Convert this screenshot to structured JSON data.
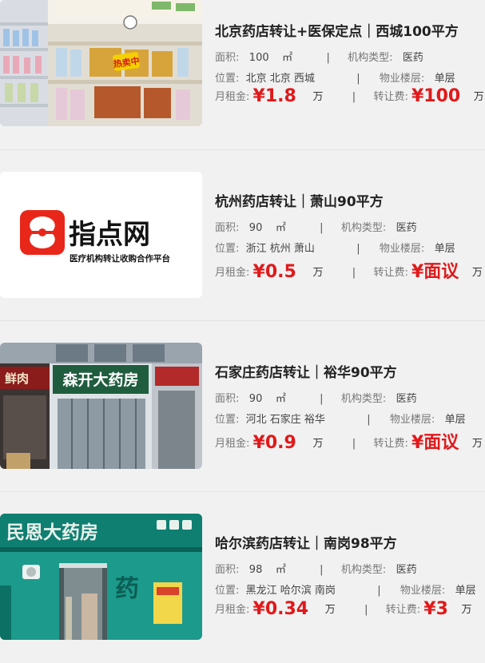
{
  "labels": {
    "area": "面积:",
    "org_type": "机构类型:",
    "location": "位置:",
    "floor": "物业楼层:",
    "rent": "月租金:",
    "transfer": "转让费:",
    "area_unit": "㎡",
    "money_unit": "万",
    "separator": "|"
  },
  "listings": [
    {
      "title": "北京药店转让+医保定点｜西城100平方",
      "area": "100",
      "org_type": "医药",
      "location": "北京 北京 西城",
      "floor": "单层",
      "rent": "¥1.8",
      "transfer": "¥100",
      "image": {
        "kind": "pharmacy-interior",
        "banner": "热卖中"
      }
    },
    {
      "title": "杭州药店转让｜萧山90平方",
      "area": "90",
      "org_type": "医药",
      "location": "浙江 杭州 萧山",
      "floor": "单层",
      "rent": "¥0.5",
      "transfer": "¥面议",
      "image": {
        "kind": "logo",
        "logo_text": "指点网",
        "logo_sub": "医疗机构转让收购合作平台",
        "brand_color": "#e8271a"
      }
    },
    {
      "title": "石家庄药店转让｜裕华90平方",
      "area": "90",
      "org_type": "医药",
      "location": "河北 石家庄 裕华",
      "floor": "单层",
      "rent": "¥0.9",
      "transfer": "¥面议",
      "image": {
        "kind": "storefront",
        "sign": "森开大药房",
        "left_sign": "鲜肉"
      }
    },
    {
      "title": "哈尔滨药店转让｜南岗98平方",
      "area": "98",
      "org_type": "医药",
      "location": "黑龙江 哈尔滨 南岗",
      "floor": "单层",
      "rent": "¥0.34",
      "transfer": "¥3",
      "image": {
        "kind": "storefront-teal",
        "sign": "民恩大药房",
        "wall_text": "药"
      }
    }
  ],
  "colors": {
    "price": "#e0191b",
    "background": "#f1f1f1"
  }
}
